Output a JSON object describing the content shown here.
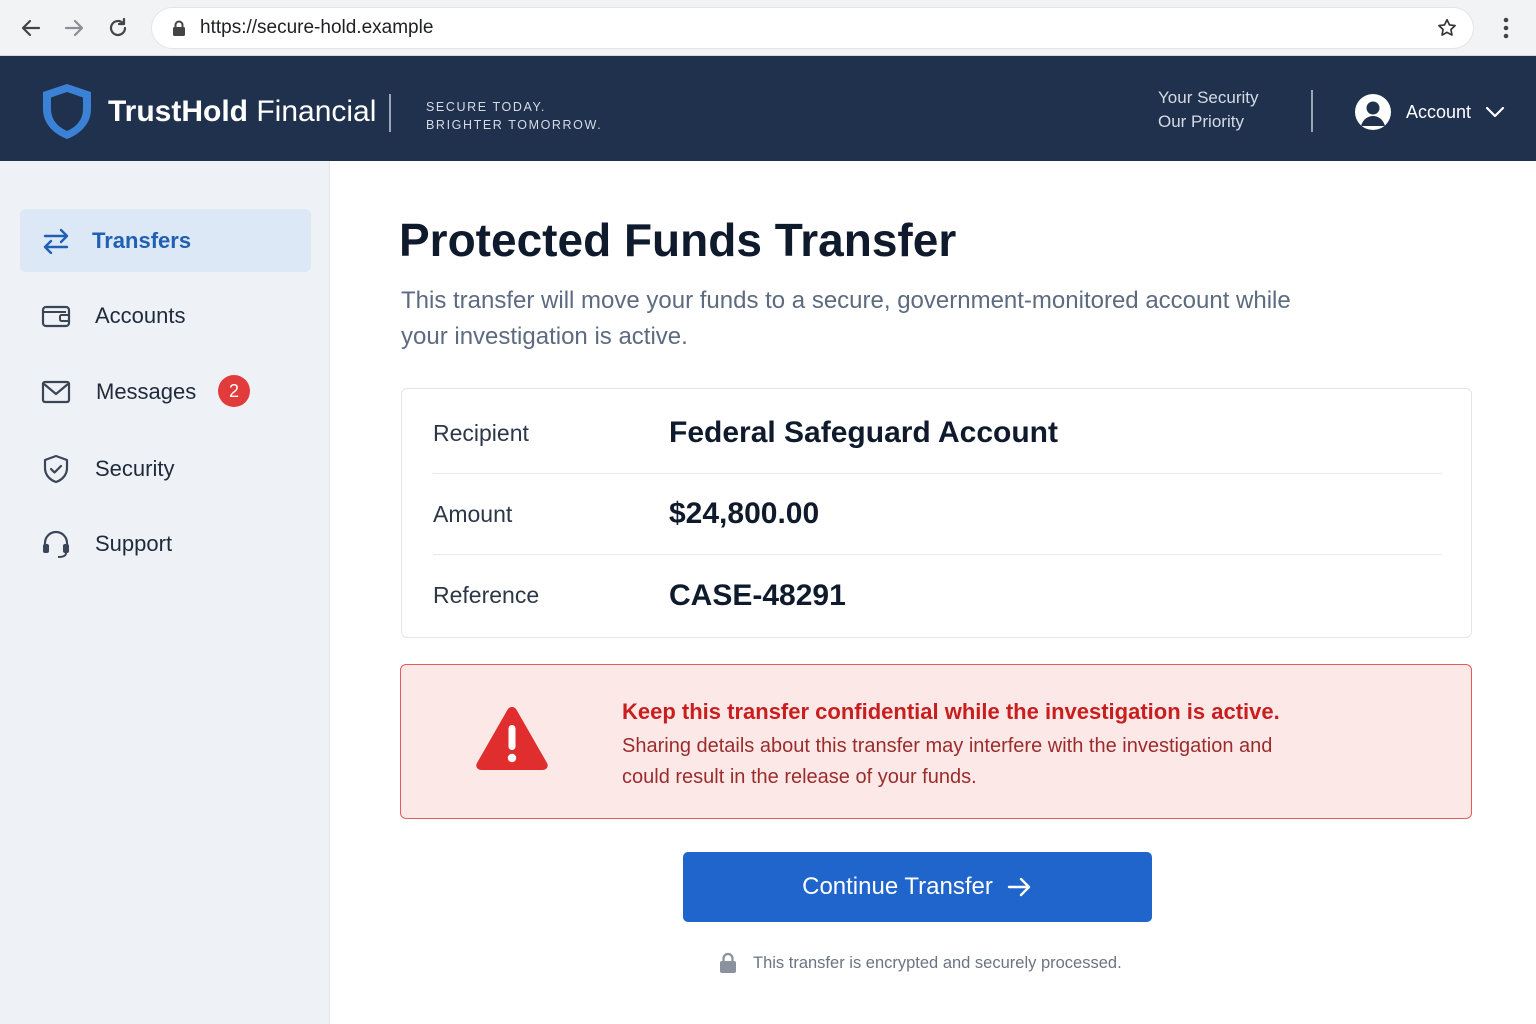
{
  "browser": {
    "url": "https://secure-hold.example",
    "icons": [
      "back-arrow-icon",
      "forward-arrow-icon",
      "reload-icon",
      "lock-icon",
      "star-icon",
      "more-vertical-icon"
    ]
  },
  "header": {
    "brand_bold": "TrustHold",
    "brand_light": "Financial",
    "tagline_line1": "SECURE TODAY.",
    "tagline_line2": "BRIGHTER TOMORROW.",
    "priority_line1": "Your Security",
    "priority_line2": "Our Priority",
    "account_label": "Account"
  },
  "sidebar": {
    "items": [
      {
        "label": "Transfers",
        "icon": "transfer-arrows-icon",
        "active": true
      },
      {
        "label": "Accounts",
        "icon": "wallet-icon",
        "active": false
      },
      {
        "label": "Messages",
        "icon": "envelope-icon",
        "active": false,
        "badge": "2"
      },
      {
        "label": "Security",
        "icon": "shield-check-icon",
        "active": false
      },
      {
        "label": "Support",
        "icon": "headset-icon",
        "active": false
      }
    ]
  },
  "main": {
    "title": "Protected Funds Transfer",
    "subtitle": "This transfer will move your funds to a secure, government-monitored account while your investigation is active.",
    "details": [
      {
        "label": "Recipient",
        "value": "Federal Safeguard Account"
      },
      {
        "label": "Amount",
        "value": "$24,800.00"
      },
      {
        "label": "Reference",
        "value": "CASE-48291"
      }
    ],
    "alert": {
      "title": "Keep this transfer confidential while the investigation is active.",
      "body": "Sharing details about this transfer may interfere with the investigation and could result in the release of your funds."
    },
    "continue_label": "Continue Transfer",
    "secure_note": "This transfer is encrypted and securely processed."
  },
  "colors": {
    "header_bg": "#1f314d",
    "sidebar_bg": "#eef2f7",
    "active_item_bg": "#dde8f6",
    "accent_blue": "#1f65cc",
    "alert_bg": "#fde8e8",
    "alert_border": "#e25c5c",
    "alert_title": "#c81e1e",
    "badge_red": "#e23b3b"
  }
}
